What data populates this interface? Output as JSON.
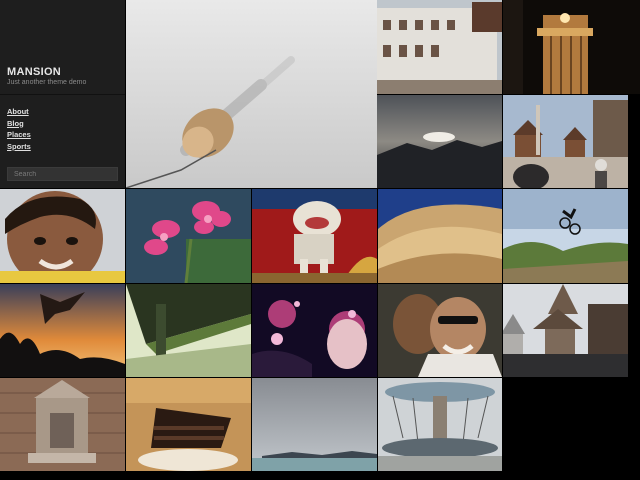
{
  "site": {
    "title": "MANSION",
    "tagline": "Just another theme demo"
  },
  "nav": {
    "items": [
      "About",
      "Blog",
      "Places",
      "Sports"
    ]
  },
  "search": {
    "placeholder": "Search"
  },
  "gallery": {
    "photos": [
      "photo-foggy-pier-post",
      "photo-white-building-street",
      "photo-temple-pillar-night",
      "photo-sunset-over-mountains",
      "photo-temple-square-crowd",
      "photo-smiling-child",
      "photo-pink-flowers",
      "photo-lion-statue",
      "photo-abstract-curves",
      "photo-bmx-jump-sky",
      "photo-skater-silhouette-sunset",
      "photo-bridge-underside",
      "photo-concert-lights",
      "photo-couple-selfie",
      "photo-pagodas",
      "photo-stone-shrine",
      "photo-chocolate-cake",
      "photo-misty-lake",
      "photo-carousel-ride"
    ]
  }
}
